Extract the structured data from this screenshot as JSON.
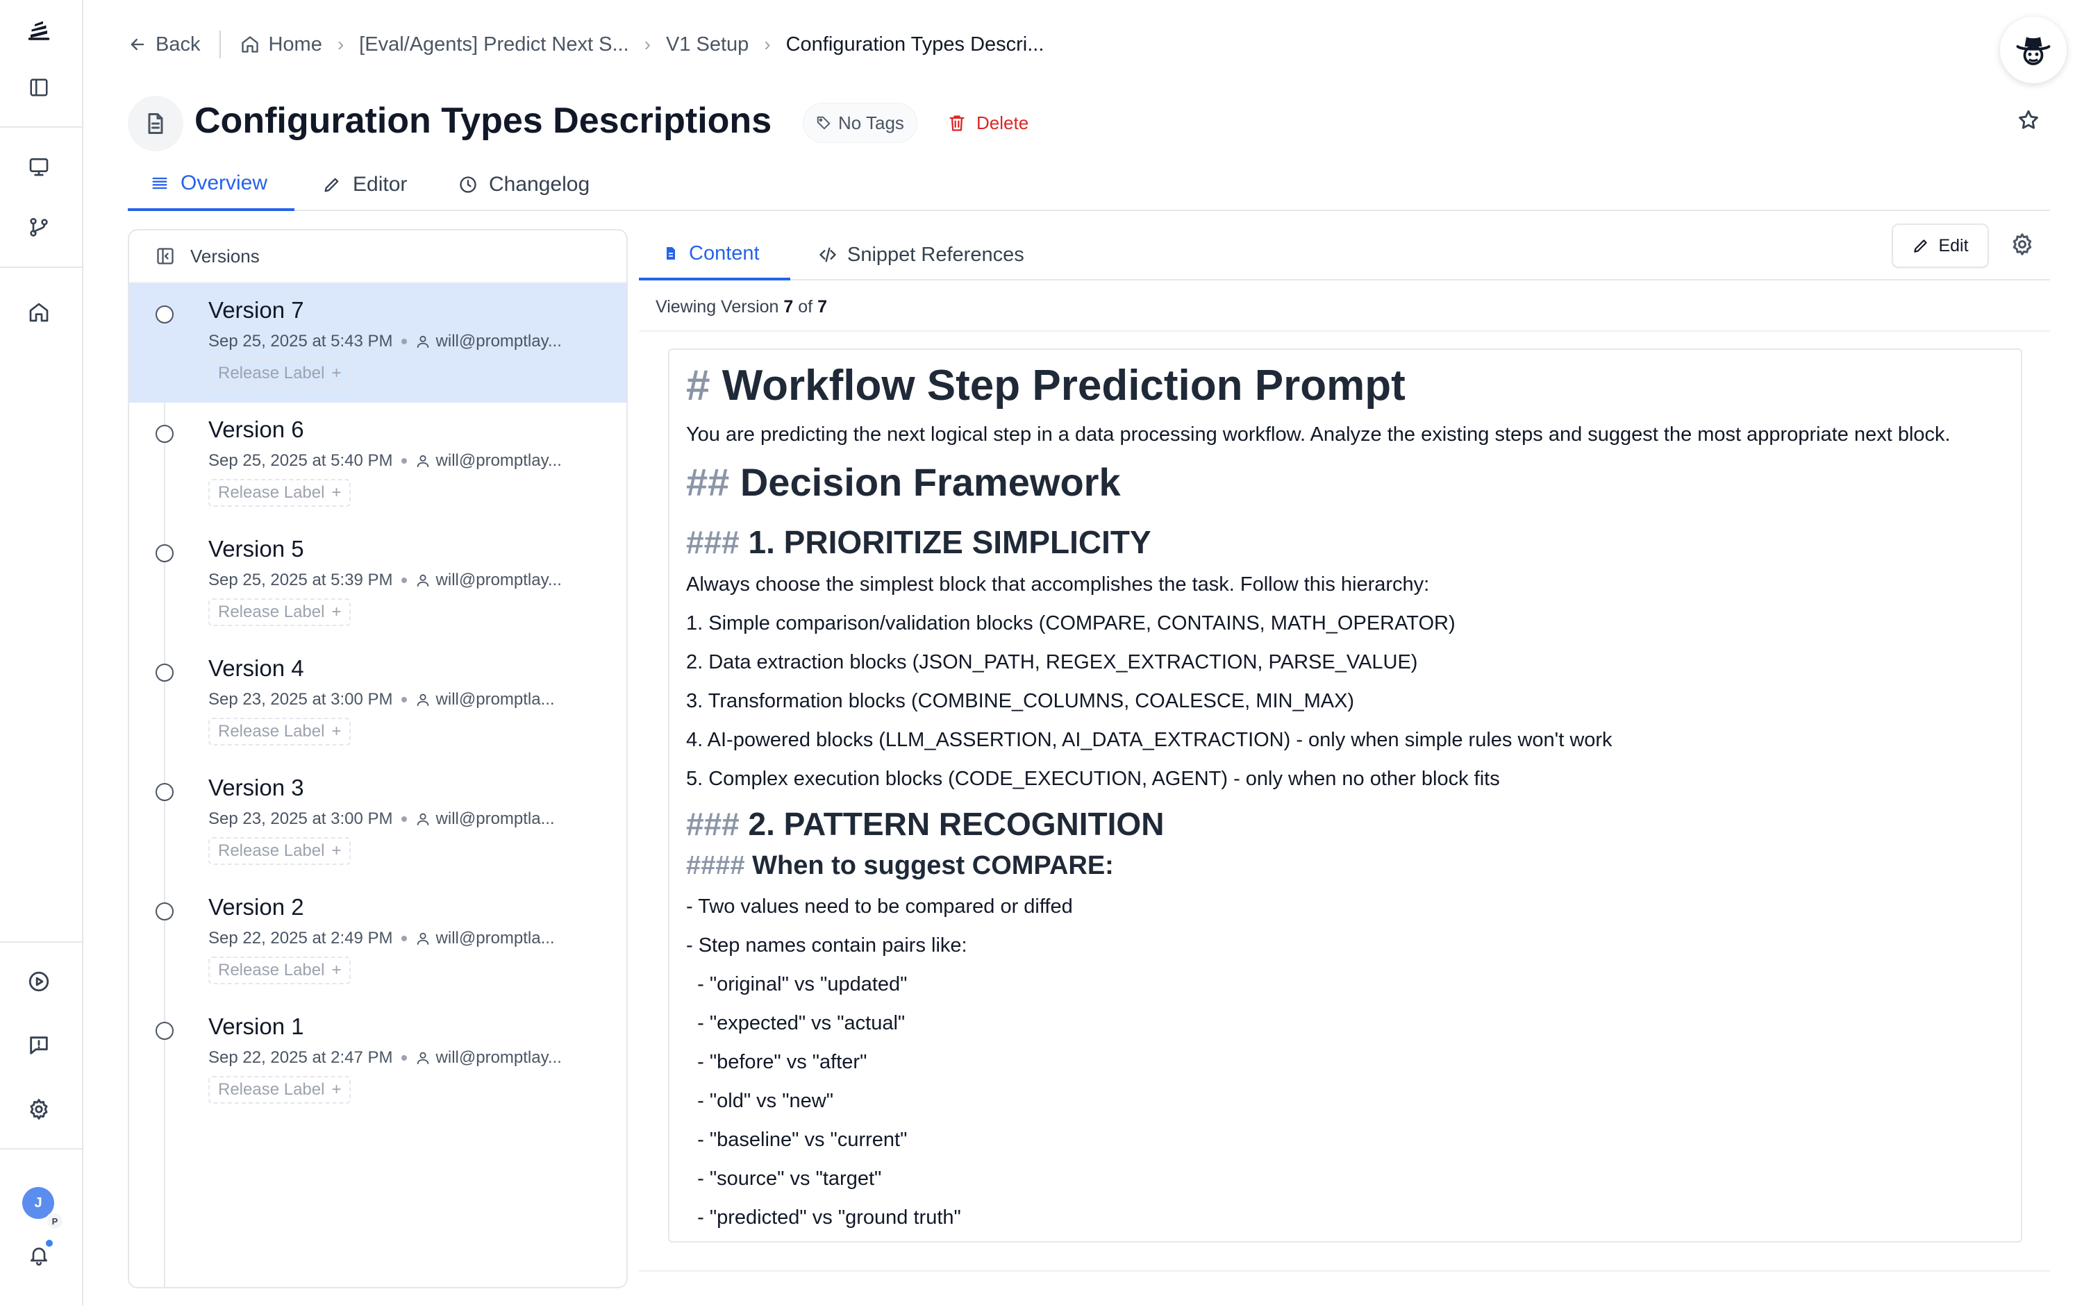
{
  "breadcrumb": {
    "back": "Back",
    "home": "Home",
    "project": "[Eval/Agents] Predict Next S...",
    "folder": "V1 Setup",
    "current": "Configuration Types Descri..."
  },
  "header": {
    "title": "Configuration Types Descriptions",
    "tags": "No Tags",
    "delete": "Delete"
  },
  "tabs": {
    "overview": "Overview",
    "editor": "Editor",
    "changelog": "Changelog"
  },
  "versions_panel": {
    "title": "Versions",
    "release_label": "Release Label",
    "items": [
      {
        "title": "Version 7",
        "date": "Sep 25, 2025 at 5:43 PM",
        "author": "will@promptlay..."
      },
      {
        "title": "Version 6",
        "date": "Sep 25, 2025 at 5:40 PM",
        "author": "will@promptlay..."
      },
      {
        "title": "Version 5",
        "date": "Sep 25, 2025 at 5:39 PM",
        "author": "will@promptlay..."
      },
      {
        "title": "Version 4",
        "date": "Sep 23, 2025 at 3:00 PM",
        "author": "will@promptla..."
      },
      {
        "title": "Version 3",
        "date": "Sep 23, 2025 at 3:00 PM",
        "author": "will@promptla..."
      },
      {
        "title": "Version 2",
        "date": "Sep 22, 2025 at 2:49 PM",
        "author": "will@promptla..."
      },
      {
        "title": "Version 1",
        "date": "Sep 22, 2025 at 2:47 PM",
        "author": "will@promptlay..."
      }
    ]
  },
  "content": {
    "tab_content": "Content",
    "tab_snippets": "Snippet References",
    "edit": "Edit",
    "viewing_prefix": "Viewing Version",
    "viewing_current": "7",
    "viewing_of": "of",
    "viewing_total": "7",
    "h1_hash": "#",
    "h1": "Workflow Step Prediction Prompt",
    "intro": "You are predicting the next logical step in a data processing workflow. Analyze the existing steps and suggest the most appropriate next block.",
    "h2_hash": "##",
    "h2": "Decision Framework",
    "h3a_hash": "###",
    "h3a": "1. PRIORITIZE SIMPLICITY",
    "p_simplicity": "Always choose the simplest block that accomplishes the task. Follow this hierarchy:",
    "list": [
      "1. Simple comparison/validation blocks (COMPARE, CONTAINS, MATH_OPERATOR)",
      "2. Data extraction blocks (JSON_PATH, REGEX_EXTRACTION, PARSE_VALUE)",
      "3. Transformation blocks (COMBINE_COLUMNS, COALESCE, MIN_MAX)",
      "4. AI-powered blocks (LLM_ASSERTION, AI_DATA_EXTRACTION) - only when simple rules won't work",
      "5. Complex execution blocks (CODE_EXECUTION, AGENT) - only when no other block fits"
    ],
    "h3b_hash": "###",
    "h3b": "2. PATTERN RECOGNITION",
    "h4_hash": "####",
    "h4": "When to suggest COMPARE:",
    "bullets": [
      "- Two values need to be compared or diffed",
      "- Step names contain pairs like:",
      "  - \"original\" vs \"updated\"",
      "  - \"expected\" vs \"actual\"",
      "  - \"before\" vs \"after\"",
      "  - \"old\" vs \"new\"",
      "  - \"baseline\" vs \"current\"",
      "  - \"source\" vs \"target\"",
      "  - \"predicted\" vs \"ground truth\""
    ]
  },
  "user": {
    "avatar": "J",
    "avatar_sub": "P"
  },
  "colors": {
    "accent": "#2563eb",
    "danger": "#dc2626",
    "selected_row": "#dbe7fb"
  }
}
